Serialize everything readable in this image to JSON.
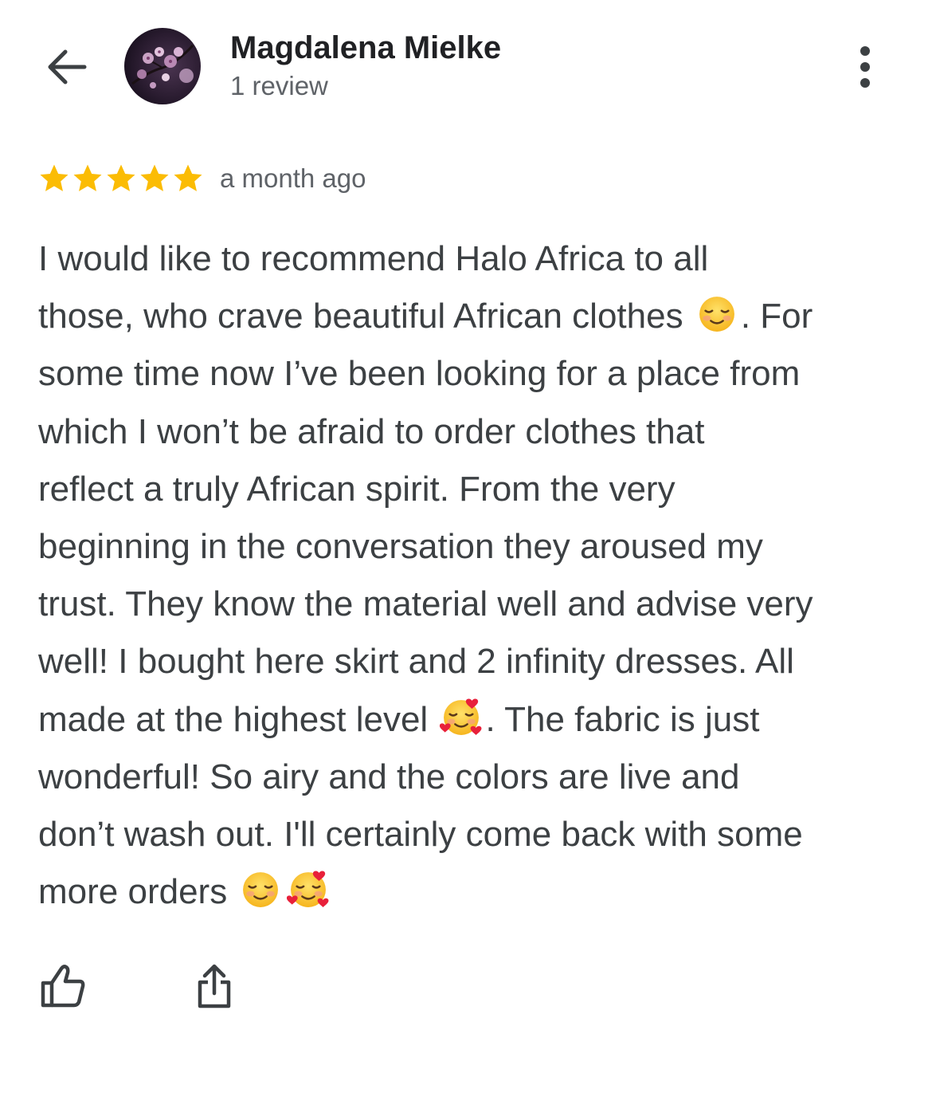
{
  "reviewer": {
    "name": "Magdalena Mielke",
    "review_count": "1 review"
  },
  "review": {
    "rating": 5,
    "max_rating": 5,
    "time": "a month ago",
    "lines": [
      {
        "text": "I would like to recommend Halo Africa to all",
        "emoji": []
      },
      {
        "text": "those, who crave beautiful African clothes ",
        "emoji": [
          "smiling-face"
        ],
        "after": ". For"
      },
      {
        "text": "some time now I’ve been looking for a place from",
        "emoji": []
      },
      {
        "text": "which I won’t be afraid to order clothes that",
        "emoji": []
      },
      {
        "text": "reflect a truly African spirit. From the very",
        "emoji": []
      },
      {
        "text": "beginning in the conversation they aroused my",
        "emoji": []
      },
      {
        "text": "trust. They know the material well and advise very",
        "emoji": []
      },
      {
        "text": "well! I bought here skirt and 2 infinity dresses. All",
        "emoji": []
      },
      {
        "text": "made at the highest level ",
        "emoji": [
          "smiling-face-with-hearts"
        ],
        "after": ". The fabric is just"
      },
      {
        "text": "wonderful! So airy and the colors are live and",
        "emoji": []
      },
      {
        "text": "don’t wash out. I'll certainly come back with some",
        "emoji": []
      },
      {
        "text": "more orders ",
        "emoji": [
          "smiling-face",
          "smiling-face-with-hearts"
        ],
        "after": ""
      }
    ]
  },
  "icons": {
    "back": "arrow-left-icon",
    "more": "more-vert-icon",
    "like": "thumb-up-icon",
    "share": "share-icon",
    "star": "star-icon"
  },
  "colors": {
    "star": "#FBBC04",
    "name": "#202124",
    "secondary": "#5f6368",
    "body": "#3c4043",
    "icon": "#3c4043"
  }
}
